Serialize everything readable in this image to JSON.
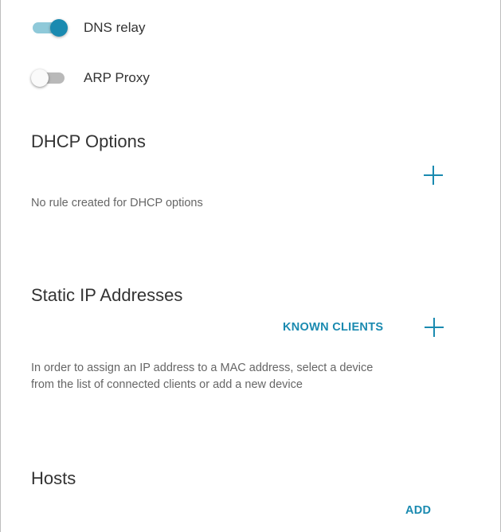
{
  "toggles": {
    "dns_relay": {
      "label": "DNS relay",
      "state": "on"
    },
    "arp_proxy": {
      "label": "ARP Proxy",
      "state": "off"
    }
  },
  "dhcp_options": {
    "title": "DHCP Options",
    "empty_text": "No rule created for DHCP options",
    "add_icon": "plus-icon"
  },
  "static_ip": {
    "title": "Static IP Addresses",
    "known_clients_label": "KNOWN CLIENTS",
    "add_icon": "plus-icon",
    "info_line1": "In order to assign an IP address to a MAC address, select a device",
    "info_line2": "from the list of connected clients or add a new device"
  },
  "hosts": {
    "title": "Hosts",
    "add_label": "ADD"
  },
  "colors": {
    "accent": "#1a8ab0",
    "toggle_on_track": "#8fc9d9",
    "toggle_off_track": "#b9b9b9",
    "text_primary": "#333333",
    "text_secondary": "#666666"
  }
}
